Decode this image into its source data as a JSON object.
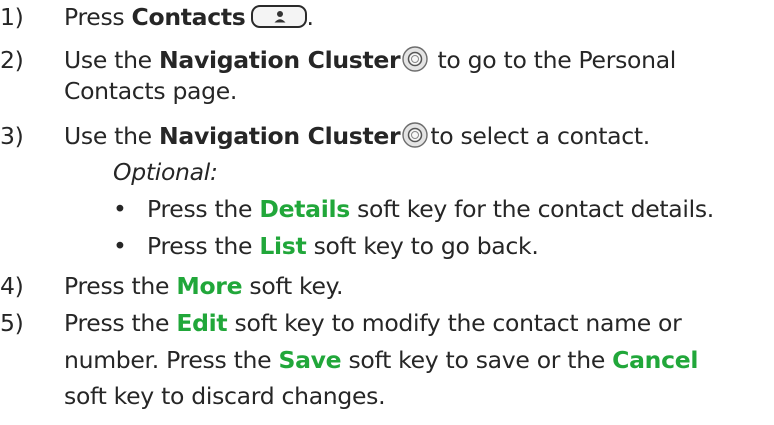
{
  "steps": [
    {
      "num": "1)",
      "prefix": "Press ",
      "bold": "Contacts",
      "suffix": "."
    },
    {
      "num": "2)",
      "prefix": "Use the ",
      "bold": "Navigation Cluster",
      "suffix_line1": " to go to the Personal",
      "line2": "Contacts page."
    },
    {
      "num": "3)",
      "prefix": "Use the ",
      "bold": "Navigation Cluster",
      "suffix": "to select a contact."
    },
    {
      "num": "4)",
      "prefix": "Press the ",
      "key": "More",
      "suffix": " soft key."
    },
    {
      "num": "5)",
      "prefix": "Press the ",
      "key": "Edit",
      "suffix_line1": " soft key to modify the contact name or",
      "line2_text": "number. Press the ",
      "line2_key1": "Save",
      "line2_mid": " soft key to save or the ",
      "line2_key2": "Cancel",
      "line3": "soft key to discard changes."
    }
  ],
  "optional": {
    "label": "Optional:",
    "bullets": [
      {
        "prefix": "Press the ",
        "key": "Details",
        "suffix": " soft key for the contact details."
      },
      {
        "prefix": "Press the ",
        "key": "List",
        "suffix": " soft key to go back."
      }
    ]
  },
  "icons": {
    "contacts_key": "contacts-person-key-icon",
    "navigation_cluster": "navigation-cluster-icon"
  },
  "colors": {
    "text": "#262626",
    "soft_key": "#21a73a"
  }
}
